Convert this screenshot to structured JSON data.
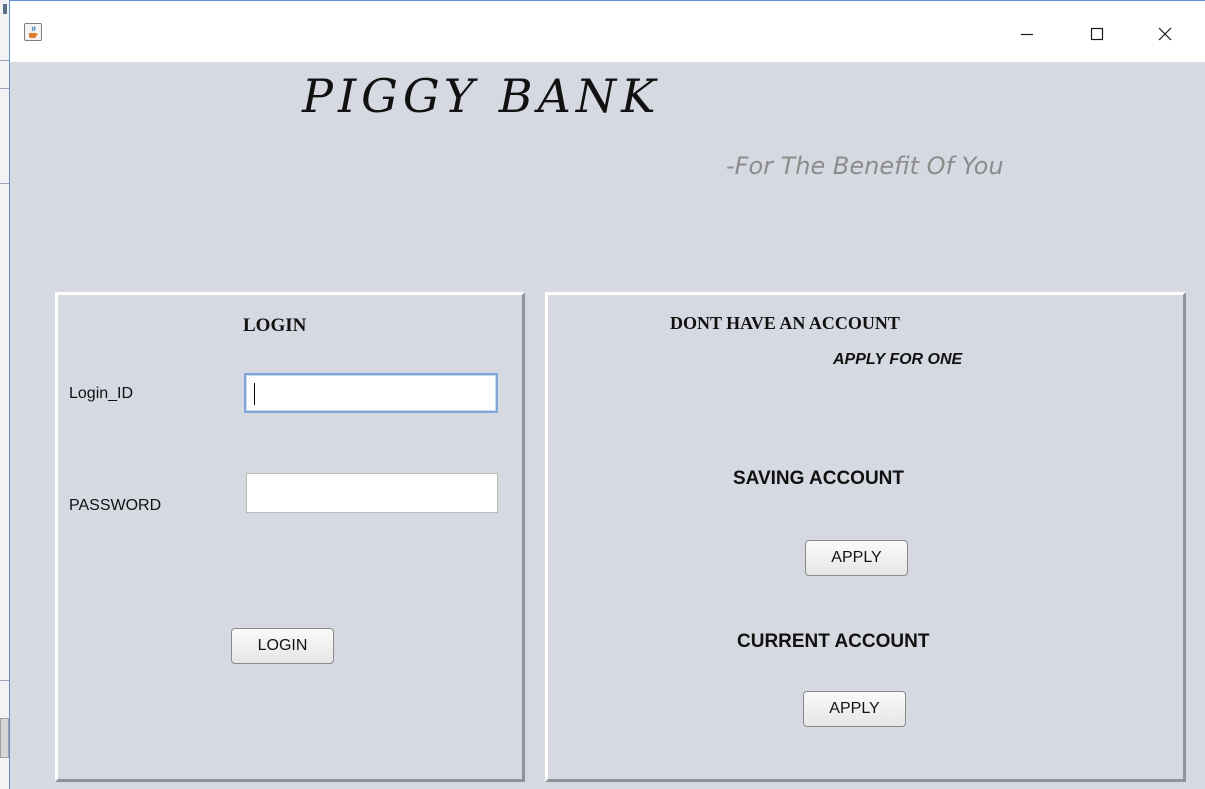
{
  "window": {
    "app_icon": "java-cup-icon",
    "controls": {
      "minimize": "minimize-icon",
      "maximize": "maximize-icon",
      "close": "close-icon"
    }
  },
  "header": {
    "title": "PIGGY BANK",
    "tagline": "-For The Benefit Of You"
  },
  "login_panel": {
    "heading": "LOGIN",
    "login_id_label": "Login_ID",
    "login_id_value": "",
    "password_label": "PASSWORD",
    "password_value": "",
    "login_button": "LOGIN"
  },
  "apply_panel": {
    "heading": "DONT HAVE AN ACCOUNT",
    "subheading": "APPLY FOR ONE",
    "saving_label": "SAVING ACCOUNT",
    "saving_button": "APPLY",
    "current_label": "CURRENT ACCOUNT",
    "current_button": "APPLY"
  },
  "colors": {
    "background": "#d6d9e1",
    "tagline": "#8c8c8c",
    "focus_border": "#7fa6d6"
  }
}
